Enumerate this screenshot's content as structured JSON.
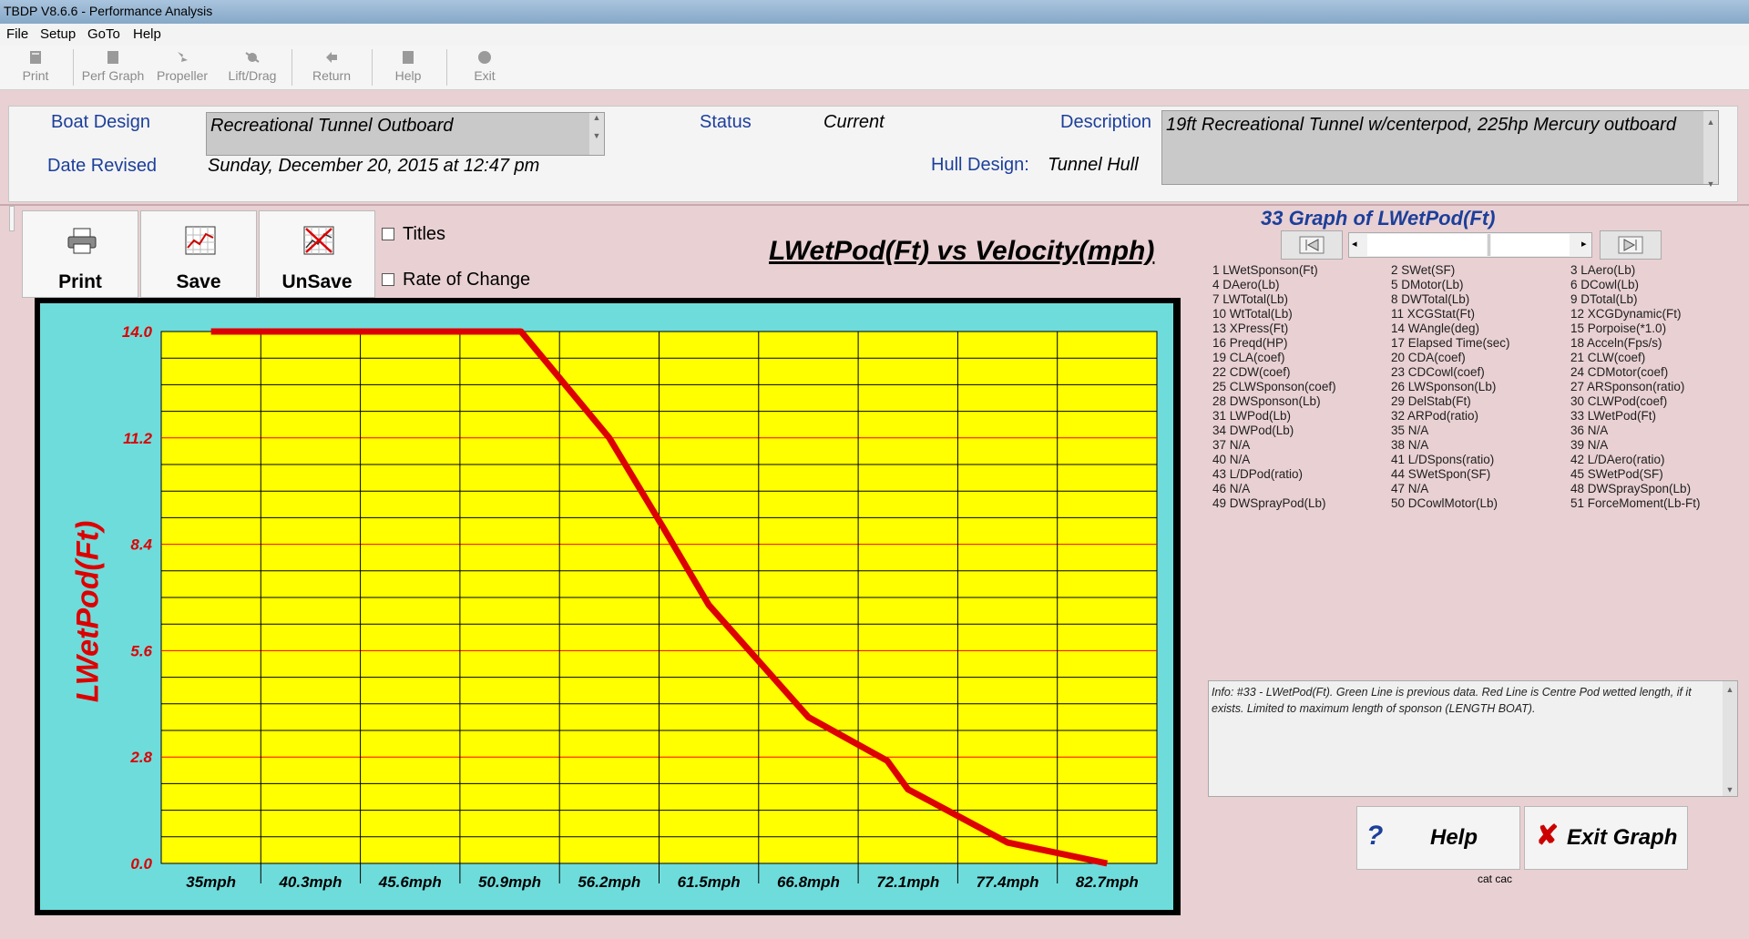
{
  "window": {
    "title": "TBDP V8.6.6 - Performance Analysis"
  },
  "menu": [
    "File",
    "Setup",
    "GoTo",
    "Help"
  ],
  "toolbar": {
    "print": "Print",
    "perf_graph": "Perf Graph",
    "propeller": "Propeller",
    "lift_drag": "Lift/Drag",
    "return": "Return",
    "help": "Help",
    "exit": "Exit"
  },
  "header": {
    "boat_design_label": "Boat Design",
    "boat_design_value": "Recreational Tunnel Outboard",
    "date_revised_label": "Date Revised",
    "date_revised_value": "Sunday, December 20, 2015 at 12:47 pm",
    "status_label": "Status",
    "status_value": "Current",
    "description_label": "Description",
    "description_value": "19ft Recreational Tunnel w/centerpod, 225hp Mercury outboard",
    "hull_design_label": "Hull Design:",
    "hull_design_value": "Tunnel Hull"
  },
  "graph_buttons": {
    "print": "Print",
    "save": "Save",
    "unsave": "UnSave"
  },
  "options": {
    "titles": "Titles",
    "rate_of_change": "Rate of Change"
  },
  "graph_selector": {
    "title": "33 Graph of LWetPod(Ft)"
  },
  "variables": [
    "1 LWetSponson(Ft)",
    "2 SWet(SF)",
    "3 LAero(Lb)",
    "4 DAero(Lb)",
    "5 DMotor(Lb)",
    "6 DCowl(Lb)",
    "7 LWTotal(Lb)",
    "8 DWTotal(Lb)",
    "9 DTotal(Lb)",
    "10 WtTotal(Lb)",
    "11 XCGStat(Ft)",
    "12 XCGDynamic(Ft)",
    "13 XPress(Ft)",
    "14 WAngle(deg)",
    "15 Porpoise(*1.0)",
    "16 Preqd(HP)",
    "17 Elapsed Time(sec)",
    "18 Acceln(Fps/s)",
    "19 CLA(coef)",
    "20 CDA(coef)",
    "21 CLW(coef)",
    "22 CDW(coef)",
    "23 CDCowl(coef)",
    "24 CDMotor(coef)",
    "25 CLWSponson(coef)",
    "26 LWSponson(Lb)",
    "27 ARSponson(ratio)",
    "28 DWSponson(Lb)",
    "29 DelStab(Ft)",
    "30 CLWPod(coef)",
    "31 LWPod(Lb)",
    "32 ARPod(ratio)",
    "33 LWetPod(Ft)",
    "34 DWPod(Lb)",
    "35 N/A",
    "36 N/A",
    "37 N/A",
    "38 N/A",
    "39 N/A",
    "40 N/A",
    "41 L/DSpons(ratio)",
    "42 L/DAero(ratio)",
    "43 L/DPod(ratio)",
    "44 SWetSpon(SF)",
    "45 SWetPod(SF)",
    "46 N/A",
    "47 N/A",
    "48 DWSpraySpon(Lb)",
    "49 DWSprayPod(Lb)",
    "50 DCowlMotor(Lb)",
    "51 ForceMoment(Lb-Ft)"
  ],
  "info": {
    "text": "Info: #33 - LWetPod(Ft). Green Line is previous data. Red Line is Centre Pod wetted length, if it exists. Limited to maximum length of sponson (LENGTH BOAT)."
  },
  "actions": {
    "help": "Help",
    "exit_graph": "Exit Graph",
    "footer_note": "cat cac"
  },
  "colors": {
    "line": "#dd0000",
    "plot_bg": "#ffff00",
    "frame_bg": "#6fdcdc",
    "label_blue": "#1c3f9a"
  },
  "chart_data": {
    "type": "line",
    "title": "LWetPod(Ft) vs Velocity(mph)",
    "ylabel": "LWetPod(Ft)",
    "xlabel": "",
    "categories": [
      "35mph",
      "40.3mph",
      "45.6mph",
      "50.9mph",
      "56.2mph",
      "61.5mph",
      "66.8mph",
      "72.1mph",
      "77.4mph",
      "82.7mph"
    ],
    "yticks": [
      "0.0",
      "2.8",
      "5.6",
      "8.4",
      "11.2",
      "14.0"
    ],
    "ylim": [
      0,
      14
    ],
    "xlim": [
      32.35,
      85.35
    ],
    "grid": true,
    "series": [
      {
        "x": [
          35,
          40.3,
          45.6,
          50.9,
          51.5,
          56.2,
          59.0,
          61.5,
          66.8,
          71.0,
          72.1,
          77.4,
          82.7
        ],
        "y": [
          14.0,
          14.0,
          14.0,
          14.0,
          14.0,
          11.2,
          8.9,
          6.8,
          3.85,
          2.7,
          1.95,
          0.55,
          0.0
        ]
      }
    ]
  }
}
